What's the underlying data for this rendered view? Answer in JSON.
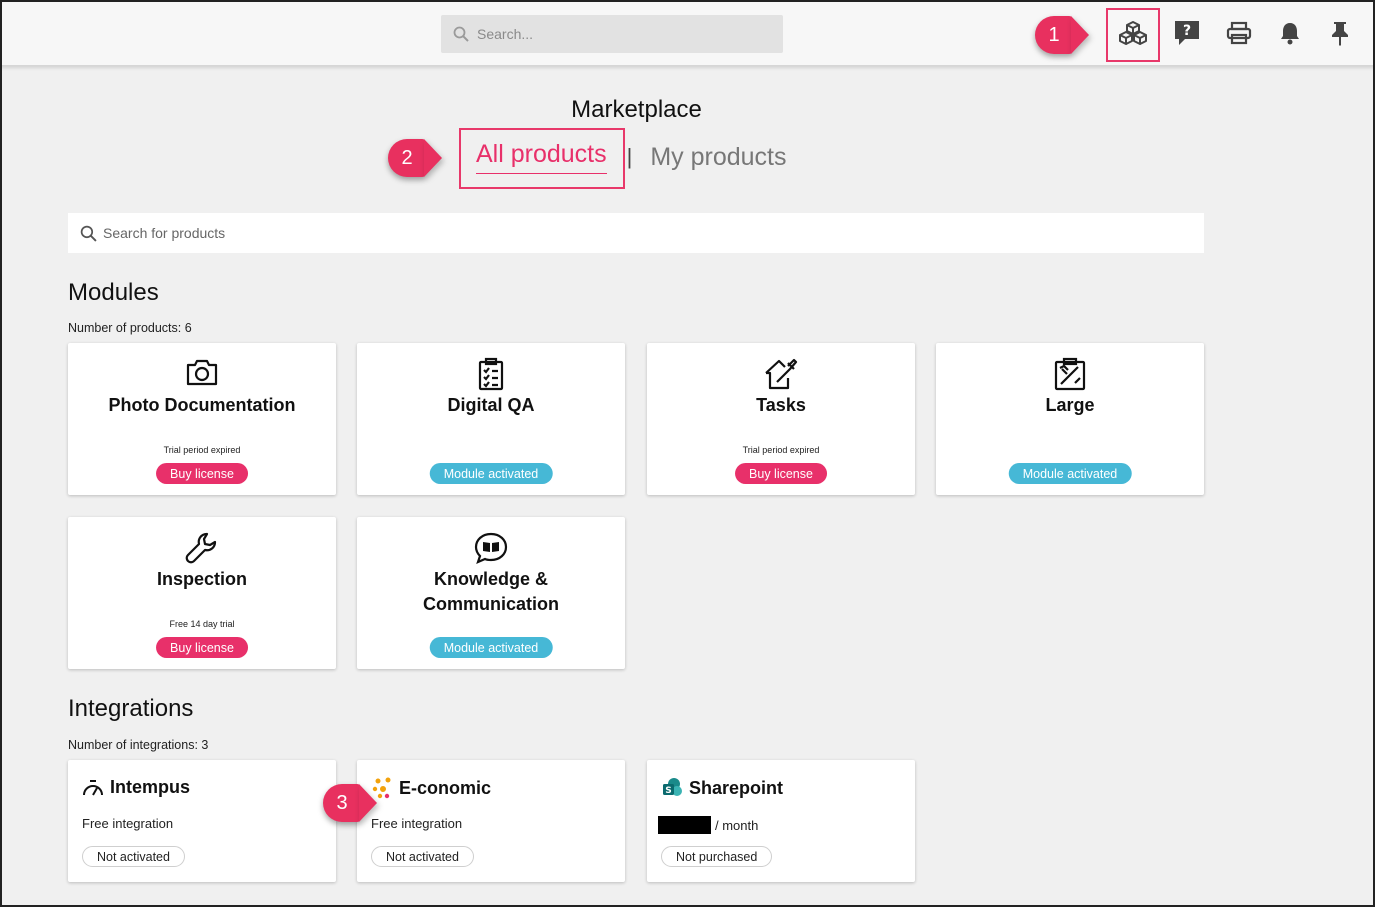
{
  "topbar": {
    "search_placeholder": "Search...",
    "icons": [
      "marketplace-cubes-icon",
      "help-icon",
      "print-icon",
      "bell-icon",
      "pin-icon"
    ]
  },
  "callouts": [
    "1",
    "2",
    "3"
  ],
  "page": {
    "title": "Marketplace",
    "tabs": [
      {
        "label": "All products",
        "active": true
      },
      {
        "label": "My products",
        "active": false
      }
    ],
    "tab_separator": "|",
    "product_search_placeholder": "Search for products"
  },
  "modules": {
    "title": "Modules",
    "count_text": "Number of products: 6",
    "items": [
      {
        "name": "Photo Documentation",
        "icon": "camera-icon",
        "note": "Trial period expired",
        "button": "Buy license",
        "status": "buy"
      },
      {
        "name": "Digital QA",
        "icon": "clipboard-checklist-icon",
        "note": "",
        "button": "Module activated",
        "status": "active"
      },
      {
        "name": "Tasks",
        "icon": "house-wrench-icon",
        "note": "Trial period expired",
        "button": "Buy license",
        "status": "buy"
      },
      {
        "name": "Large",
        "icon": "clipboard-tools-icon",
        "note": "",
        "button": "Module activated",
        "status": "active"
      },
      {
        "name": "Inspection",
        "icon": "wrench-icon",
        "note": "Free 14 day trial",
        "button": "Buy license",
        "status": "buy"
      },
      {
        "name": "Knowledge & Communication",
        "icon": "chat-book-icon",
        "note": "",
        "button": "Module activated",
        "status": "active"
      }
    ]
  },
  "integrations": {
    "title": "Integrations",
    "count_text": "Number of integrations: 3",
    "items": [
      {
        "name": "Intempus",
        "icon": "stopwatch-icon",
        "subtitle": "Free integration",
        "status": "Not activated"
      },
      {
        "name": "E-conomic",
        "icon": "economic-logo-icon",
        "subtitle": "Free integration",
        "status": "Not activated"
      },
      {
        "name": "Sharepoint",
        "icon": "sharepoint-logo-icon",
        "subtitle": "/ month",
        "status": "Not purchased"
      }
    ]
  },
  "colors": {
    "accent": "#e8306a",
    "activated": "#46b8d6",
    "background": "#f0f0f0"
  }
}
